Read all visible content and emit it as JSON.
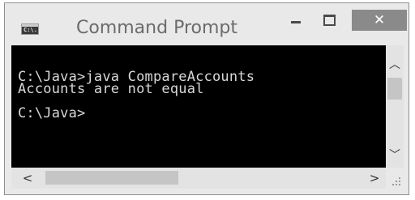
{
  "window": {
    "title": "Command Prompt",
    "icon": "cmd-icon",
    "icon_text": "C:\\."
  },
  "controls": {
    "minimize": "minimize-icon",
    "maximize": "maximize-icon",
    "close_glyph": "✕"
  },
  "console": {
    "lines": [
      "C:\\Java>java CompareAccounts",
      "Accounts are not equal",
      "",
      "C:\\Java>"
    ]
  },
  "scrollbars": {
    "up_glyph": "︿",
    "down_glyph": "﹀",
    "left_glyph": "<",
    "right_glyph": ">"
  }
}
